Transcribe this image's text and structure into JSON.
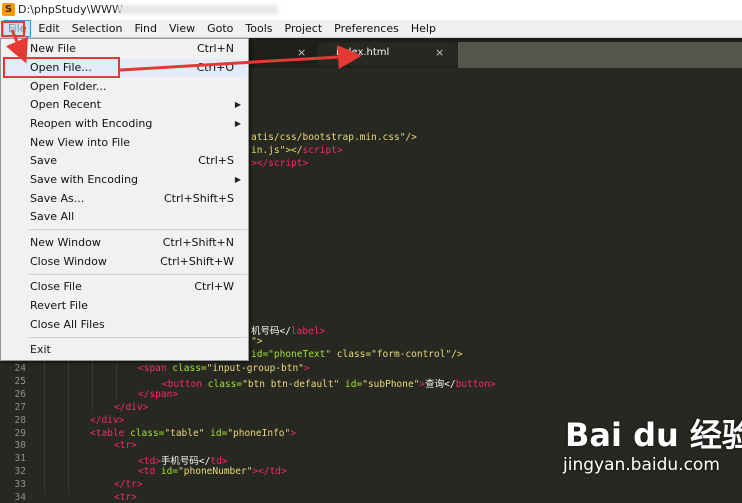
{
  "window": {
    "app_icon": "S",
    "title": "D:\\phpStudy\\WWW"
  },
  "menubar": [
    "File",
    "Edit",
    "Selection",
    "Find",
    "View",
    "Goto",
    "Tools",
    "Project",
    "Preferences",
    "Help"
  ],
  "tabs": [
    {
      "label": "",
      "close": "×"
    },
    {
      "label": "index.html",
      "close": "×"
    }
  ],
  "file_menu": [
    {
      "label": "New File",
      "shortcut": "Ctrl+N",
      "submenu": false
    },
    {
      "label": "Open File...",
      "shortcut": "Ctrl+O",
      "submenu": false
    },
    {
      "label": "Open Folder...",
      "shortcut": "",
      "submenu": false
    },
    {
      "label": "Open Recent",
      "shortcut": "",
      "submenu": true
    },
    {
      "label": "Reopen with Encoding",
      "shortcut": "",
      "submenu": true
    },
    {
      "label": "New View into File",
      "shortcut": "",
      "submenu": false
    },
    {
      "label": "Save",
      "shortcut": "Ctrl+S",
      "submenu": false
    },
    {
      "label": "Save with Encoding",
      "shortcut": "",
      "submenu": true
    },
    {
      "label": "Save As...",
      "shortcut": "Ctrl+Shift+S",
      "submenu": false
    },
    {
      "label": "Save All",
      "shortcut": "",
      "submenu": false
    },
    {
      "label": "New Window",
      "shortcut": "Ctrl+Shift+N",
      "submenu": false
    },
    {
      "label": "Close Window",
      "shortcut": "Ctrl+Shift+W",
      "submenu": false
    },
    {
      "label": "Close File",
      "shortcut": "Ctrl+W",
      "submenu": false
    },
    {
      "label": "Revert File",
      "shortcut": "",
      "submenu": false
    },
    {
      "label": "Close All Files",
      "shortcut": "",
      "submenu": false
    },
    {
      "label": "Exit",
      "shortcut": "",
      "submenu": false
    }
  ],
  "code_fragments": {
    "frag1": "atis/css/bootstrap.min.css\"/>",
    "frag2a": "in.js\"></",
    "frag2b": "script",
    "frag2c": ">",
    "frag3a": "></",
    "frag3b": "script",
    "frag3c": ">",
    "frag4a": "机号码</",
    "frag4b": "label",
    "frag4c": ">",
    "frag5": "\">",
    "frag6a": "id=\"phoneText\"",
    "frag6b": " class=\"form-control\"/>"
  },
  "code_lines": [
    {
      "n": "24",
      "parts": [
        [
          "t",
          "<span"
        ],
        [
          "a",
          " class="
        ],
        [
          "s",
          "\"input-group-btn\""
        ],
        [
          "t",
          ">"
        ]
      ]
    },
    {
      "n": "25",
      "parts": [
        [
          "t",
          "<button"
        ],
        [
          "a",
          " class="
        ],
        [
          "s",
          "\"btn btn-default\""
        ],
        [
          "a",
          " id="
        ],
        [
          "s",
          "\"subPhone\""
        ],
        [
          "t",
          ">"
        ],
        [
          "p",
          "查询</"
        ],
        [
          "t",
          "button"
        ],
        [
          "t",
          ">"
        ]
      ]
    },
    {
      "n": "26",
      "parts": [
        [
          "t",
          "</span>"
        ]
      ]
    },
    {
      "n": "27",
      "parts": [
        [
          "t",
          "</div>"
        ]
      ]
    },
    {
      "n": "28",
      "parts": [
        [
          "t",
          "</div>"
        ]
      ]
    },
    {
      "n": "29",
      "parts": [
        [
          "t",
          "<table"
        ],
        [
          "a",
          " class="
        ],
        [
          "s",
          "\"table\""
        ],
        [
          "a",
          " id="
        ],
        [
          "s",
          "\"phoneInfo\""
        ],
        [
          "t",
          ">"
        ]
      ]
    },
    {
      "n": "30",
      "parts": [
        [
          "t",
          "<tr>"
        ]
      ]
    },
    {
      "n": "31",
      "parts": [
        [
          "t",
          "<td>"
        ],
        [
          "p",
          "手机号码</"
        ],
        [
          "t",
          "td"
        ],
        [
          "t",
          ">"
        ]
      ]
    },
    {
      "n": "32",
      "parts": [
        [
          "t",
          "<td"
        ],
        [
          "a",
          " id="
        ],
        [
          "s",
          "\"phoneNumber\""
        ],
        [
          "t",
          "></td>"
        ]
      ]
    },
    {
      "n": "33",
      "parts": [
        [
          "t",
          "</tr>"
        ]
      ]
    },
    {
      "n": "34",
      "parts": [
        [
          "t",
          "<tr>"
        ]
      ]
    }
  ],
  "watermark": {
    "logo": "Bai du 经验",
    "url": "jingyan.baidu.com"
  },
  "colors": {
    "annotation_red": "#e53935",
    "editor_bg": "#272822",
    "tag": "#f92672",
    "attr": "#a6e22e",
    "string": "#e6db74"
  }
}
